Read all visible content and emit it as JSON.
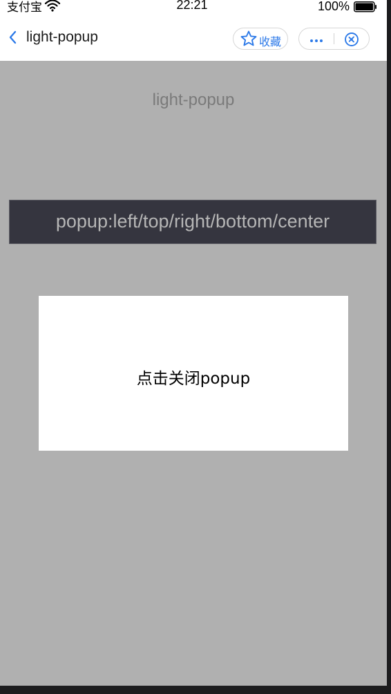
{
  "status_bar": {
    "carrier": "支付宝",
    "time": "22:21",
    "battery": "100%"
  },
  "nav": {
    "title": "light-popup",
    "favorite_label": "收藏"
  },
  "page": {
    "title": "light-popup",
    "popup_bar_label": "popup:left/top/right/bottom/center",
    "popup_close_text": "点击关闭popup"
  },
  "colors": {
    "accent": "#2d7ae8",
    "overlay": "#b0b0b0",
    "bar": "#35353f"
  },
  "icons": [
    "wifi-icon",
    "battery-icon",
    "back-icon",
    "star-icon",
    "more-icon",
    "close-mini-icon"
  ]
}
